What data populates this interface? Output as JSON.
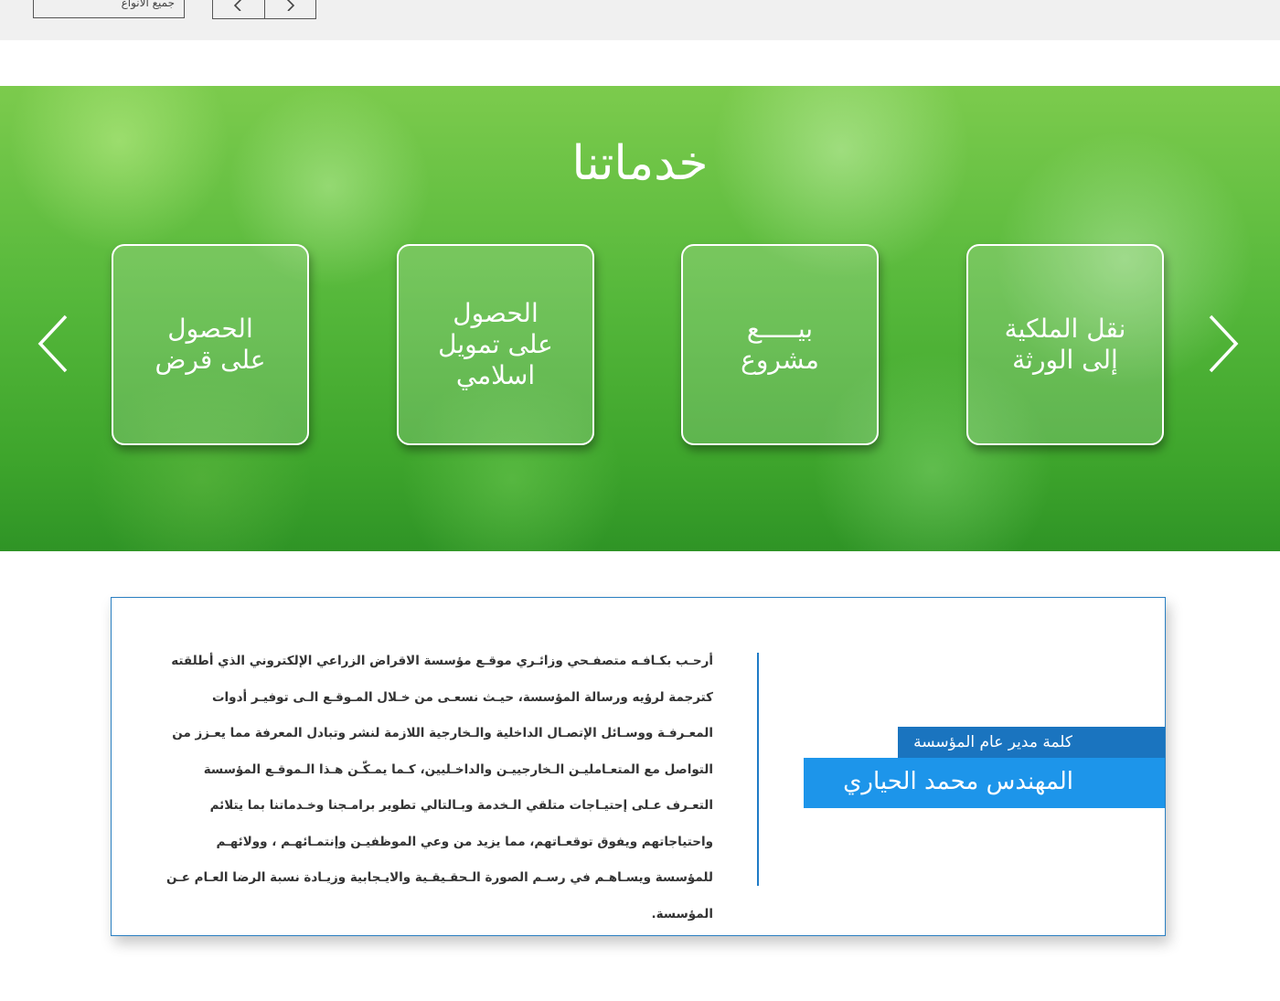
{
  "top": {
    "select_value": "جميع الأنواع",
    "prev_icon": "chevron-left-icon",
    "next_icon": "chevron-right-icon"
  },
  "services": {
    "title": "خدماتنا",
    "cards": [
      {
        "label": "نقل الملكية\nإلى الورثة"
      },
      {
        "label": "بيـــــع\nمشروع"
      },
      {
        "label": "الحصول\nعلى تمويل\nاسلامي"
      },
      {
        "label": "الحصول\nعلى قرض"
      }
    ],
    "prev_icon": "chevron-left-icon",
    "next_icon": "chevron-right-icon"
  },
  "director": {
    "caption": "كلمة مدير عام المؤسسة",
    "name": "المهندس محمد الحياري",
    "message": "أرحـب بكـافـه متصفـحي وزائـري موقـع مؤسسة الاقراض الزراعي  الإلكتروني الذي أطلقته كترجمة لرؤيه ورسالة المؤسسة، حيـث نسعـى من خـلال المـوقـع  الـى توفيـر أدوات المعـرفـة ووسـائل الإتصـال الداخلية والـخارجية اللازمة لنشر وتبادل المعرفة مما يعـزز من التواصل مع المتعـامليـن الـخارجييـن والداخـليين، كـما يمـكّـن هـذا الـموقـع المؤسسة التعـرف عـلى إحتيـاجات متلقي الـخدمة وبـالتالي تطوير برامـجنا وخـدماتنا بما يتلائم واحتياجاتهم ويفوق توقعـاتهم، مما يزيد من وعي الموظفيـن وإنتمـائهـم ، وولائهـم للمؤسسة ويسـاهـم في رسـم الصورة الـحقـيقـية والايـجابية وزيـادة نسبة الرضا العـام عـن المؤسسة."
  },
  "colors": {
    "accent_blue": "#1d95ea",
    "dark_blue": "#1a74bf",
    "border_blue": "#2a7fc1",
    "banner_green": "#56b83b"
  }
}
